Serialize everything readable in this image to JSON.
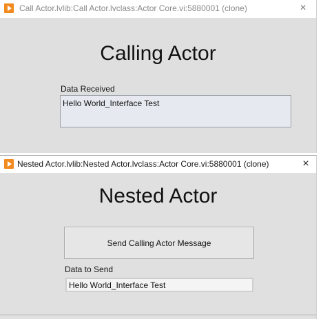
{
  "calling_window": {
    "title": "Call Actor.lvlib:Call Actor.lvclass:Actor Core.vi:5880001 (clone)",
    "close_icon": "×",
    "heading": "Calling Actor",
    "data_received_label": "Data Received",
    "data_received_value": "Hello World_Interface Test"
  },
  "nested_window": {
    "title": "Nested Actor.lvlib:Nested Actor.lvclass:Actor Core.vi:5880001 (clone)",
    "close_icon": "×",
    "heading": "Nested Actor",
    "send_button_label": "Send Calling Actor Message",
    "data_to_send_label": "Data to Send",
    "data_to_send_value": "Hello World_Interface Test"
  },
  "colors": {
    "app_icon": "#f18a1f",
    "window_bg": "#e0e0e0",
    "indicator_bg": "#e6eaf0"
  }
}
